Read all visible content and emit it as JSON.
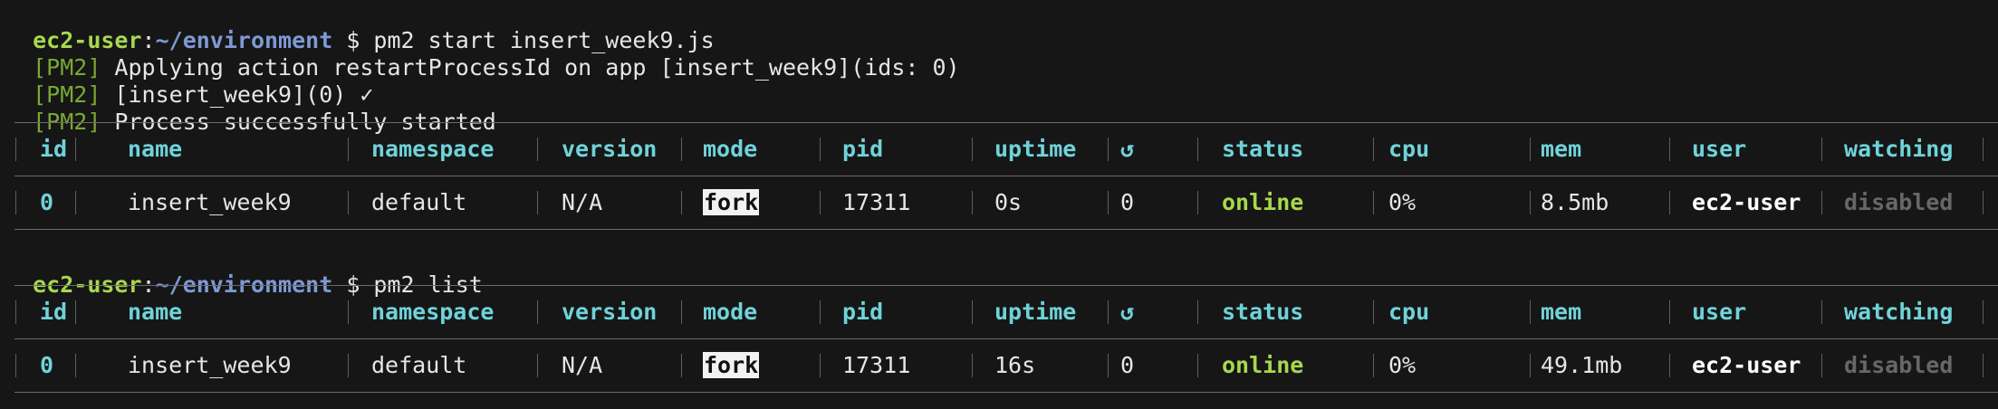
{
  "terminal": {
    "lines": [
      {
        "kind": "prompt",
        "user": "ec2-user",
        "colon": ":",
        "path": "~/environment",
        "command": " $ pm2 start insert_week9.js"
      },
      {
        "kind": "pm2",
        "tag": "[PM2]",
        "text": " Applying action restartProcessId on app [insert_week9](ids: 0)"
      },
      {
        "kind": "pm2",
        "tag": "[PM2]",
        "text": " [insert_week9](0) ✓"
      },
      {
        "kind": "pm2",
        "tag": "[PM2]",
        "text": " Process successfully started"
      },
      {
        "kind": "prompt",
        "user": "ec2-user",
        "colon": ":",
        "path": "~/environment",
        "command": " $ pm2 list"
      }
    ]
  },
  "tables": [
    {
      "headers": {
        "id": "id",
        "name": "name",
        "namespace": "namespace",
        "version": "version",
        "mode": "mode",
        "pid": "pid",
        "uptime": "uptime",
        "restarts": "↺",
        "status": "status",
        "cpu": "cpu",
        "mem": "mem",
        "user": "user",
        "watching": "watching"
      },
      "row": {
        "id": "0",
        "name": "insert_week9",
        "namespace": "default",
        "version": "N/A",
        "mode": "fork",
        "pid": "17311",
        "uptime": "0s",
        "restarts": "0",
        "status": "online",
        "cpu": "0%",
        "mem": "8.5mb",
        "user": "ec2-user",
        "watching": "disabled"
      }
    },
    {
      "headers": {
        "id": "id",
        "name": "name",
        "namespace": "namespace",
        "version": "version",
        "mode": "mode",
        "pid": "pid",
        "uptime": "uptime",
        "restarts": "↺",
        "status": "status",
        "cpu": "cpu",
        "mem": "mem",
        "user": "user",
        "watching": "watching"
      },
      "row": {
        "id": "0",
        "name": "insert_week9",
        "namespace": "default",
        "version": "N/A",
        "mode": "fork",
        "pid": "17311",
        "uptime": "16s",
        "restarts": "0",
        "status": "online",
        "cpu": "0%",
        "mem": "49.1mb",
        "user": "ec2-user",
        "watching": "disabled"
      }
    }
  ],
  "colors": {
    "background": "#161616",
    "prompt_user": "#a8d84d",
    "prompt_path": "#7d9ad6",
    "pm2_tag": "#7aa832",
    "header": "#6fd3d9",
    "online": "#a8d84d",
    "disabled": "#676767"
  }
}
